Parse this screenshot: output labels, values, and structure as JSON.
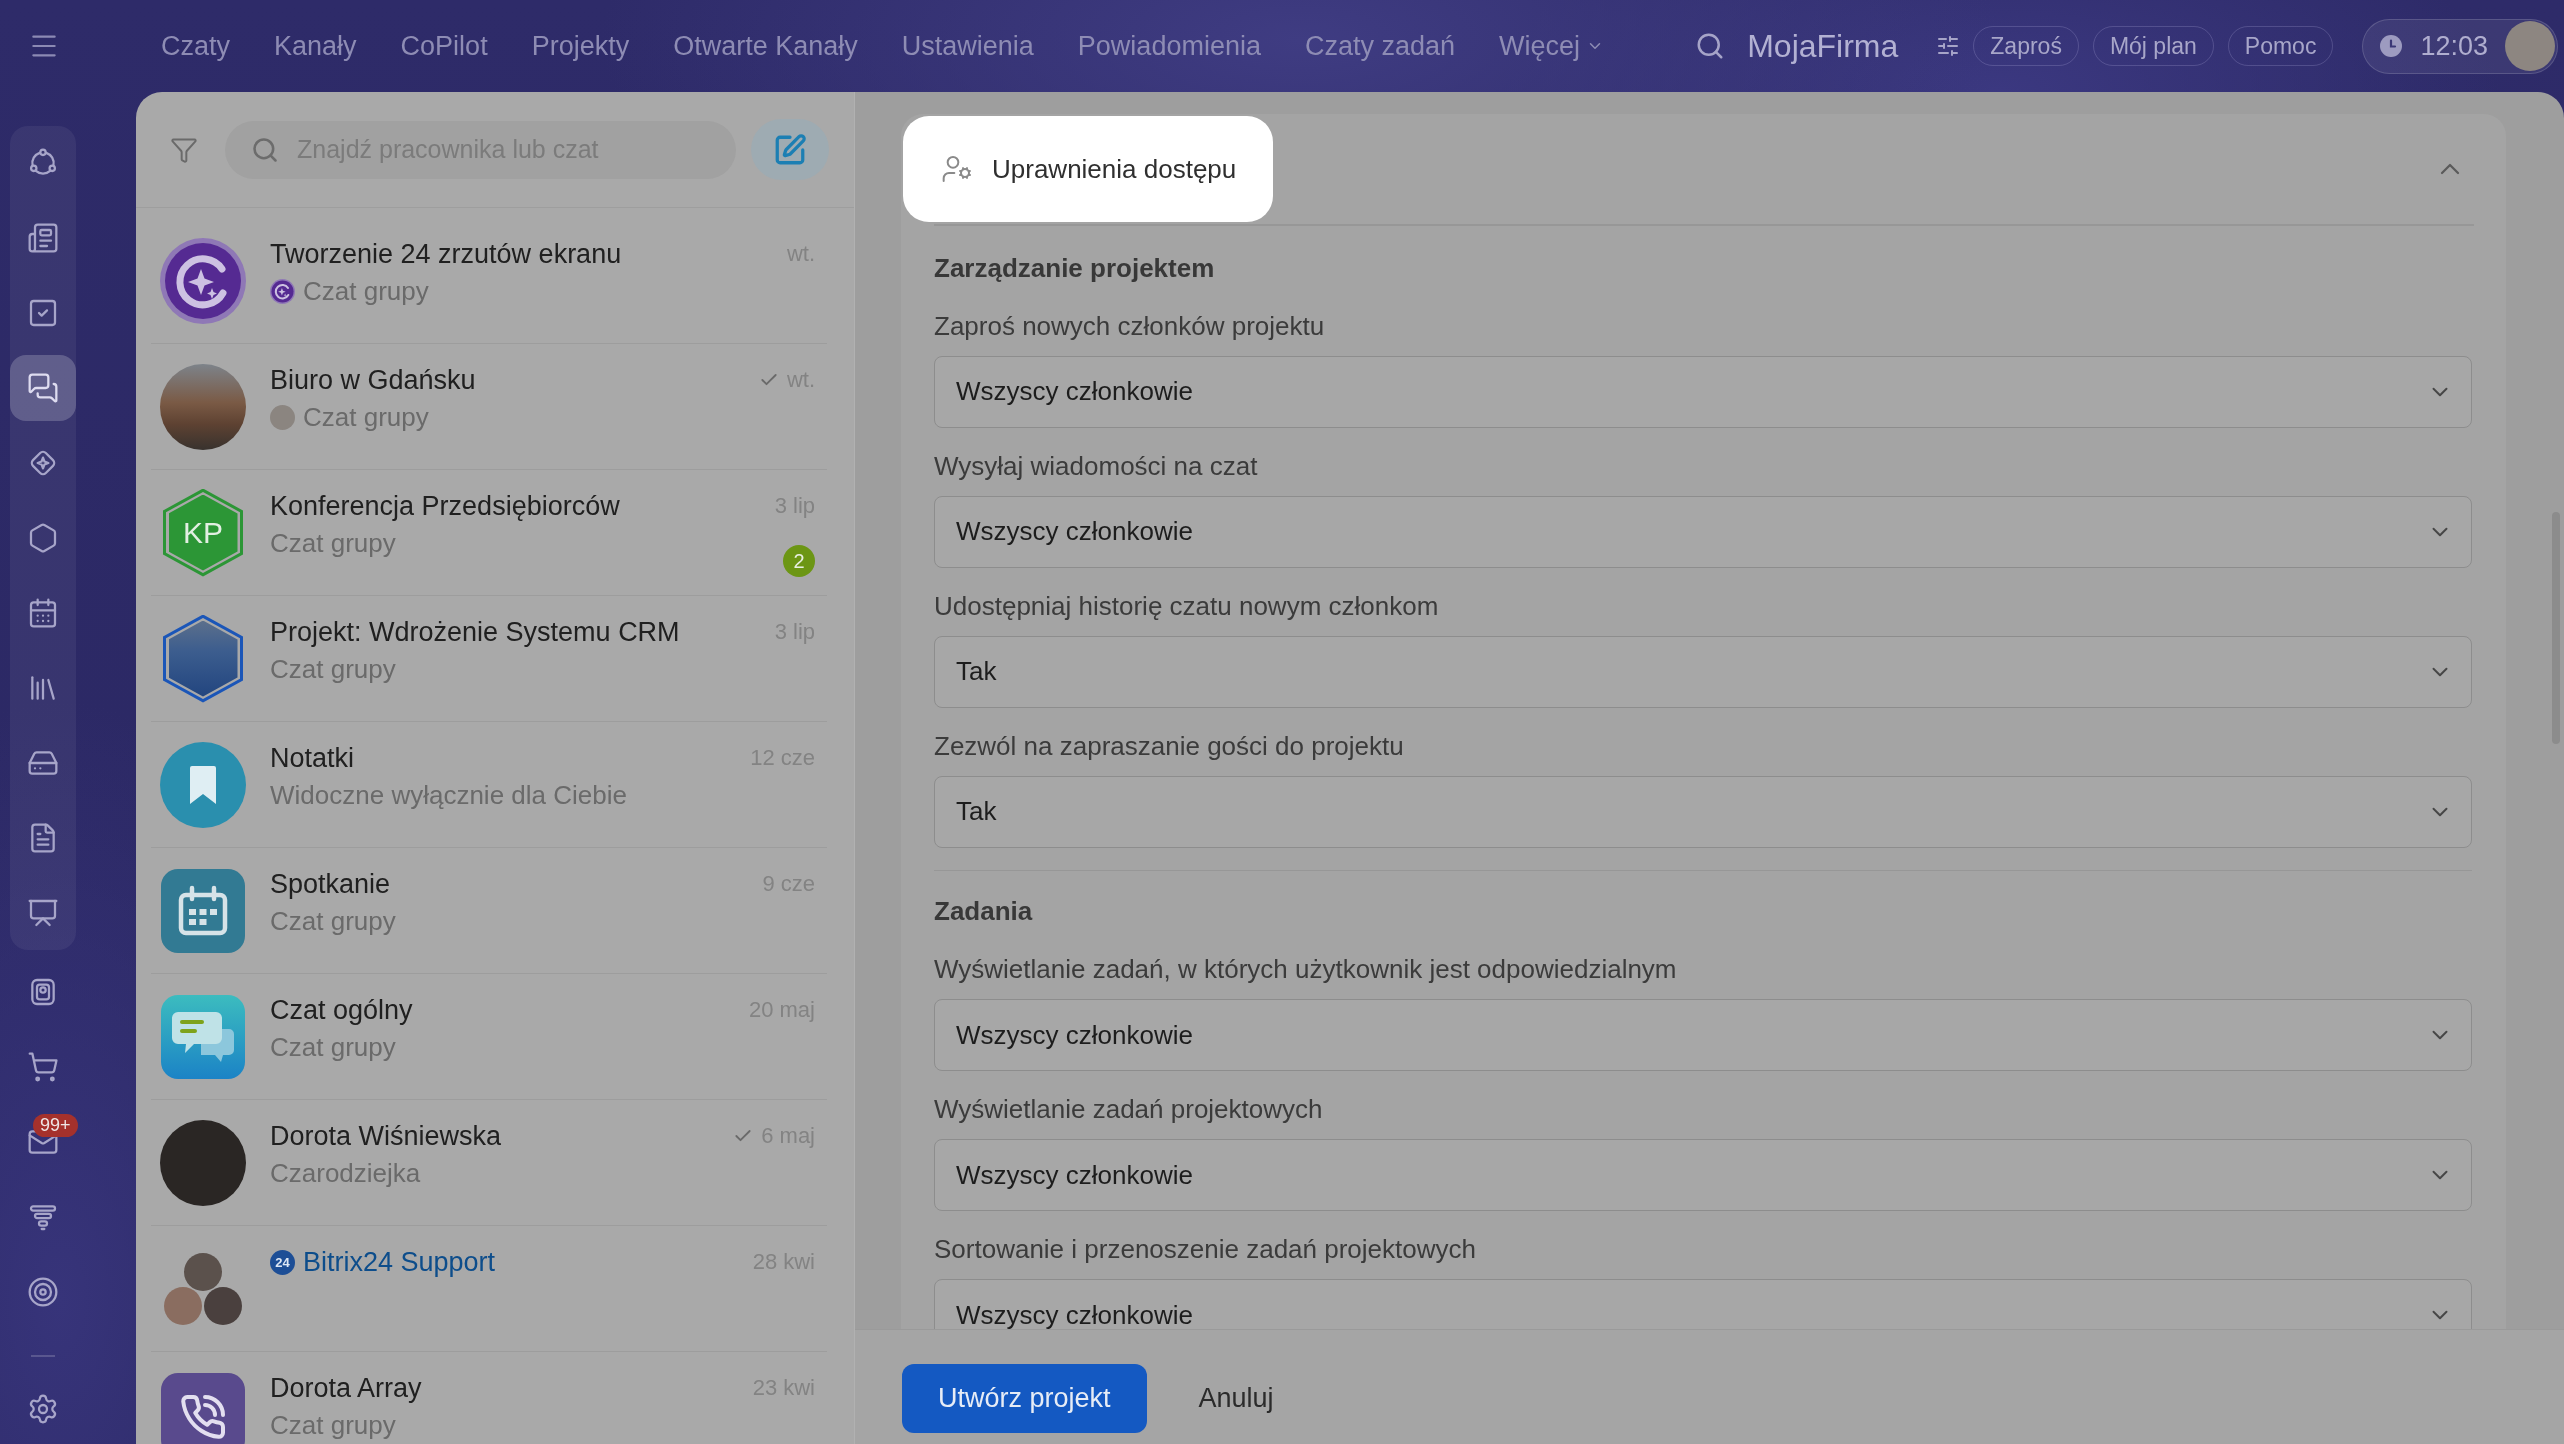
{
  "topbar": {
    "nav": [
      {
        "label": "Czaty"
      },
      {
        "label": "Kanały"
      },
      {
        "label": "CoPilot"
      },
      {
        "label": "Projekty"
      },
      {
        "label": "Otwarte Kanały"
      },
      {
        "label": "Ustawienia"
      },
      {
        "label": "Powiadomienia"
      },
      {
        "label": "Czaty zadań"
      }
    ],
    "more": "Więcej",
    "company": "MojaFirma",
    "buttons": [
      {
        "label": "Zaproś"
      },
      {
        "label": "Mój plan"
      },
      {
        "label": "Pomoc"
      }
    ],
    "clock": "12:03"
  },
  "sidebar": {
    "pinned": [
      {
        "kind": "nodes",
        "selected": false
      },
      {
        "kind": "news",
        "selected": false
      },
      {
        "kind": "tasks",
        "selected": false
      },
      {
        "kind": "chats",
        "selected": true
      },
      {
        "kind": "sparkle",
        "selected": false
      },
      {
        "kind": "hexagon",
        "selected": false
      },
      {
        "kind": "calendar",
        "selected": false
      },
      {
        "kind": "books",
        "selected": false
      },
      {
        "kind": "drive",
        "selected": false
      },
      {
        "kind": "document",
        "selected": false
      },
      {
        "kind": "board",
        "selected": false
      }
    ],
    "items": [
      {
        "kind": "card",
        "selected": false
      },
      {
        "kind": "cart",
        "selected": false
      },
      {
        "kind": "mail",
        "selected": false,
        "badge": "99+"
      },
      {
        "kind": "funnel",
        "selected": false
      },
      {
        "kind": "target",
        "selected": false
      }
    ],
    "settings": {
      "kind": "settings",
      "selected": false
    }
  },
  "chats": {
    "search": {
      "placeholder": "Znajdź pracownika lub czat"
    },
    "list": [
      {
        "kind": "logo",
        "title": "Tworzenie 24 zrzutów ekranu",
        "subtitle_avatar": {
          "kind": "logo"
        },
        "subtitle": "Czat grupy",
        "time": "wt.",
        "read": false,
        "official": false
      },
      {
        "kind": "photo",
        "title": "Biuro w Gdańsku",
        "subtitle_avatar": {
          "kind": "person"
        },
        "subtitle": "Czat grupy",
        "time": "wt.",
        "read": true,
        "official": false
      },
      {
        "kind": "initials",
        "initials": "KP",
        "title": "Konferencja Przedsiębiorców",
        "subtitle": "Czat grupy",
        "time": "3 lip",
        "unread": "2",
        "read": false,
        "official": false
      },
      {
        "kind": "project",
        "title": "Projekt: Wdrożenie Systemu CRM",
        "subtitle": "Czat grupy",
        "time": "3 lip",
        "read": false,
        "official": false
      },
      {
        "kind": "notes",
        "title": "Notatki",
        "subtitle": "Widoczne wyłącznie dla Ciebie",
        "time": "12 cze",
        "read": false,
        "official": false
      },
      {
        "kind": "meeting",
        "title": "Spotkanie",
        "subtitle": "Czat grupy",
        "time": "9 cze",
        "read": false,
        "official": false
      },
      {
        "kind": "general",
        "title": "Czat ogólny",
        "subtitle": "Czat grupy",
        "time": "20 maj",
        "read": false,
        "official": false
      },
      {
        "kind": "person",
        "title": "Dorota Wiśniewska",
        "subtitle": "Czarodziejka",
        "time": "6 maj",
        "read": true,
        "official": false
      },
      {
        "kind": "group",
        "title_badge": "24",
        "title": "Bitrix24 Support",
        "time": "28 kwi",
        "read": false,
        "official": true
      },
      {
        "kind": "call",
        "title": "Dorota Array",
        "subtitle": "Czat grupy",
        "time": "23 kwi",
        "read": false,
        "official": false
      }
    ]
  },
  "form": {
    "header": {
      "label": "Uprawnienia dostępu",
      "highlighted": true
    },
    "expanded": true,
    "sections": [
      {
        "heading": "Zarządzanie projektem",
        "fields": [
          {
            "label": "Zaproś nowych członków projektu",
            "value": "Wszyscy członkowie"
          },
          {
            "label": "Wysyłaj wiadomości na czat",
            "value": "Wszyscy członkowie"
          },
          {
            "label": "Udostępniaj historię czatu nowym członkom",
            "value": "Tak"
          },
          {
            "label": "Zezwól na zapraszanie gości do projektu",
            "value": "Tak"
          }
        ]
      },
      {
        "heading": "Zadania",
        "fields": [
          {
            "label": "Wyświetlanie zadań, w których użytkownik jest odpowiedzialnym",
            "value": "Wszyscy członkowie"
          },
          {
            "label": "Wyświetlanie zadań projektowych",
            "value": "Wszyscy członkowie"
          },
          {
            "label": "Sortowanie i przenoszenie zadań projektowych",
            "value": "Wszyscy członkowie"
          }
        ]
      }
    ],
    "buttons": [
      {
        "label": "Utwórz projekt",
        "kind": "primary"
      },
      {
        "label": "Anuluj",
        "kind": "plain"
      }
    ]
  }
}
